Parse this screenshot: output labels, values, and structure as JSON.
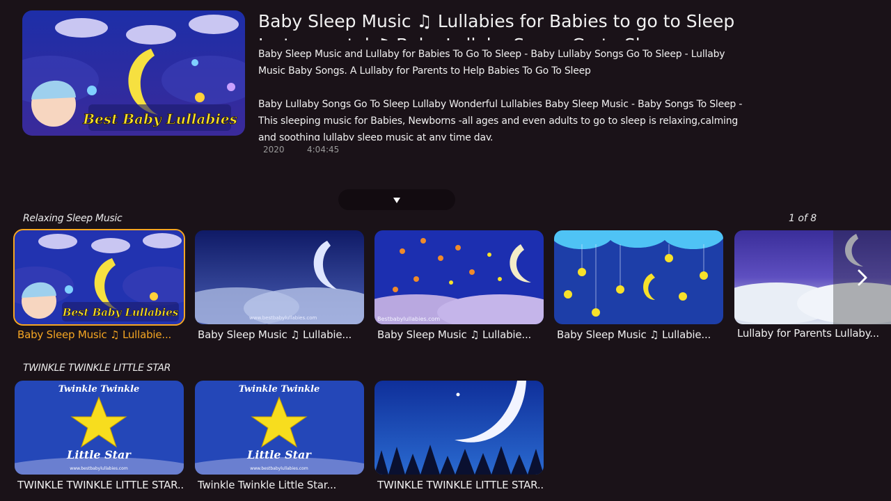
{
  "hero": {
    "title": "Baby Sleep Music ♫ Lullabies for Babies to go to Sleep Instrumental ♫ Baby Lullaby Songs Go to Sleep",
    "description": "Baby Sleep Music and Lullaby for Babies To Go To Sleep - Baby Lullaby Songs Go To Sleep - Lullaby Music Baby Songs. A Lullaby for Parents to Help Babies To Go To Sleep\n\nBaby Lullaby Songs Go To Sleep Lullaby Wonderful Lullabies Baby Sleep Music - Baby Songs To Sleep -This sleeping music for Babies, Newborns -all ages and even adults to go to sleep is relaxing,calming and soothing lullaby sleep music at any time day.",
    "year": "2020",
    "duration": "4:04:45",
    "thumb_text": "Best Baby Lullabies"
  },
  "rows": [
    {
      "title": "Relaxing Sleep Music",
      "counter": "1 of 8",
      "items": [
        {
          "label": "Baby Sleep Music ♫ Lullabie...",
          "thumb_text": "Best Baby Lullabies"
        },
        {
          "label": "Baby Sleep Music ♫ Lullabie...",
          "watermark": "www.bestbabylullabies.com"
        },
        {
          "label": "Baby Sleep Music ♫ Lullabie...",
          "watermark": "Bestbabylullabies.com"
        },
        {
          "label": "Baby Sleep Music ♫ Lullabie..."
        },
        {
          "label": "Lullaby for Parents Lullaby..."
        }
      ]
    },
    {
      "title": "TWINKLE TWINKLE LITTLE STAR",
      "items": [
        {
          "label": "TWINKLE TWINKLE LITTLE STAR...",
          "thumb_top": "Twinkle Twinkle",
          "thumb_bottom": "Little Star",
          "watermark": "www.bestbabylullabies.com"
        },
        {
          "label": "Twinkle Twinkle Little Star...",
          "thumb_top": "Twinkle Twinkle",
          "thumb_bottom": "Little Star",
          "watermark": "www.bestbabylullabies.com"
        },
        {
          "label": "TWINKLE TWINKLE LITTLE STAR..."
        }
      ]
    }
  ],
  "colors": {
    "background": "#1a1218",
    "focus": "#f5a623",
    "logo_text": "#f7e12a"
  },
  "icons": {
    "expand": "triangle-down-icon",
    "next": "chevron-right-icon"
  }
}
